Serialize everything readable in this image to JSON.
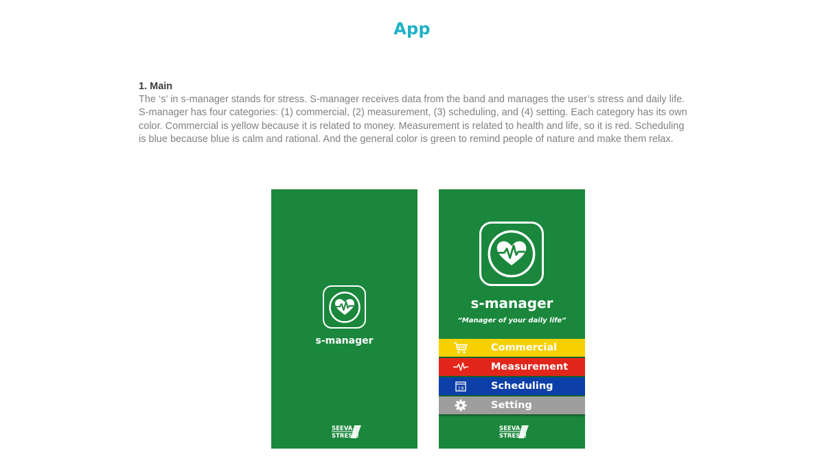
{
  "page": {
    "title": "App",
    "title_color": "#1fb1c5"
  },
  "section": {
    "heading": "1. Main",
    "body": "The ‘s’ in s-manager stands for stress. S-manager receives data from the band and manages the user’s stress and daily life. S-manager has four categories: (1) commercial, (2) measurement, (3) scheduling, and (4) setting. Each category has its own color. Commercial is yellow because it is related to money. Measurement is related to health and life, so it is red. Scheduling is blue because blue is calm and rational. And the general color is green to remind people of nature and make them relax."
  },
  "splash_screen": {
    "background_color": "#1a873c",
    "icon": "heart-pulse-icon",
    "app_name": "s-manager",
    "brand_logo": "SEEVA. STRESS!"
  },
  "menu_screen": {
    "background_color": "#1a873c",
    "icon": "heart-pulse-icon",
    "app_name": "s-manager",
    "tagline": "“Manager of your daily life”",
    "items": [
      {
        "label": "Commercial",
        "icon": "cart-icon",
        "color": "#f7d000"
      },
      {
        "label": "Measurement",
        "icon": "pulse-icon",
        "color": "#e3261c"
      },
      {
        "label": "Scheduling",
        "icon": "calendar-icon",
        "icon_text": "19",
        "color": "#0d3fa8"
      },
      {
        "label": "Setting",
        "icon": "gear-icon",
        "color": "#9e9e9e"
      }
    ],
    "brand_logo": "SEEVA. STRESS!"
  }
}
